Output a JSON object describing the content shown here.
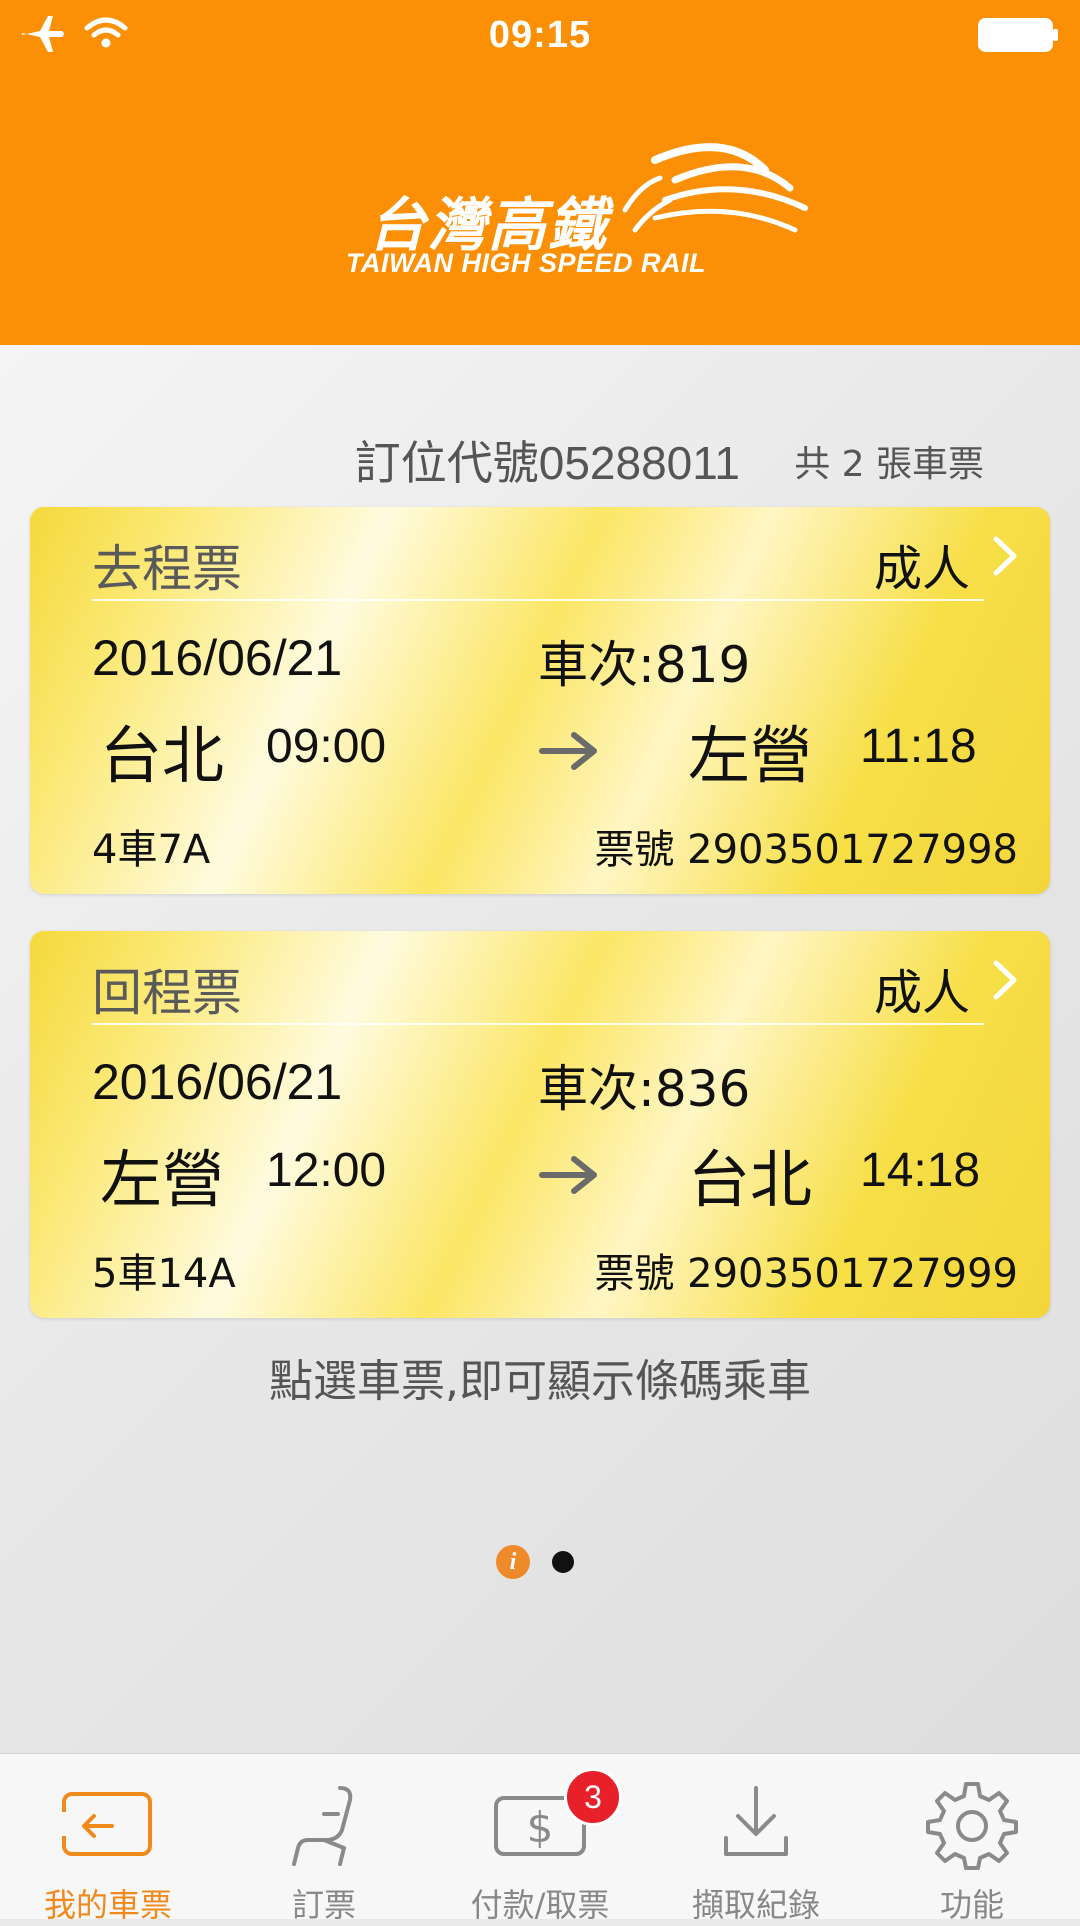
{
  "status_bar": {
    "time": "09:15"
  },
  "header": {
    "logo_cn": "台灣高鐵",
    "logo_en": "TAIWAN HIGH SPEED RAIL"
  },
  "booking": {
    "code_label": "訂位代號",
    "code": "05288011",
    "count_text": "共 2 張車票"
  },
  "tickets": [
    {
      "type": "去程票",
      "passenger": "成人",
      "date": "2016/06/21",
      "train": "車次:819",
      "from": "台北",
      "departure": "09:00",
      "to": "左營",
      "arrival": "11:18",
      "seat": "4車7A",
      "ticket_no": "票號 2903501727998"
    },
    {
      "type": "回程票",
      "passenger": "成人",
      "date": "2016/06/21",
      "train": "車次:836",
      "from": "左營",
      "departure": "12:00",
      "to": "台北",
      "arrival": "14:18",
      "seat": "5車14A",
      "ticket_no": "票號 2903501727999"
    }
  ],
  "hint": "點選車票,即可顯示條碼乘車",
  "pager": {
    "info_glyph": "i",
    "pages": 2,
    "current": 2
  },
  "tabbar": {
    "tabs": [
      {
        "label": "我的車票",
        "icon": "my-tickets-icon",
        "active": true
      },
      {
        "label": "訂票",
        "icon": "seat-icon",
        "active": false
      },
      {
        "label": "付款/取票",
        "icon": "payment-icon",
        "active": false,
        "badge": "3"
      },
      {
        "label": "擷取紀錄",
        "icon": "download-icon",
        "active": false
      },
      {
        "label": "功能",
        "icon": "gear-icon",
        "active": false
      }
    ]
  },
  "colors": {
    "brand_orange": "#fb8f05",
    "active_tab": "#f08a1c",
    "ticket_yellow": "#f4d93a",
    "badge_red": "#e8202a"
  }
}
